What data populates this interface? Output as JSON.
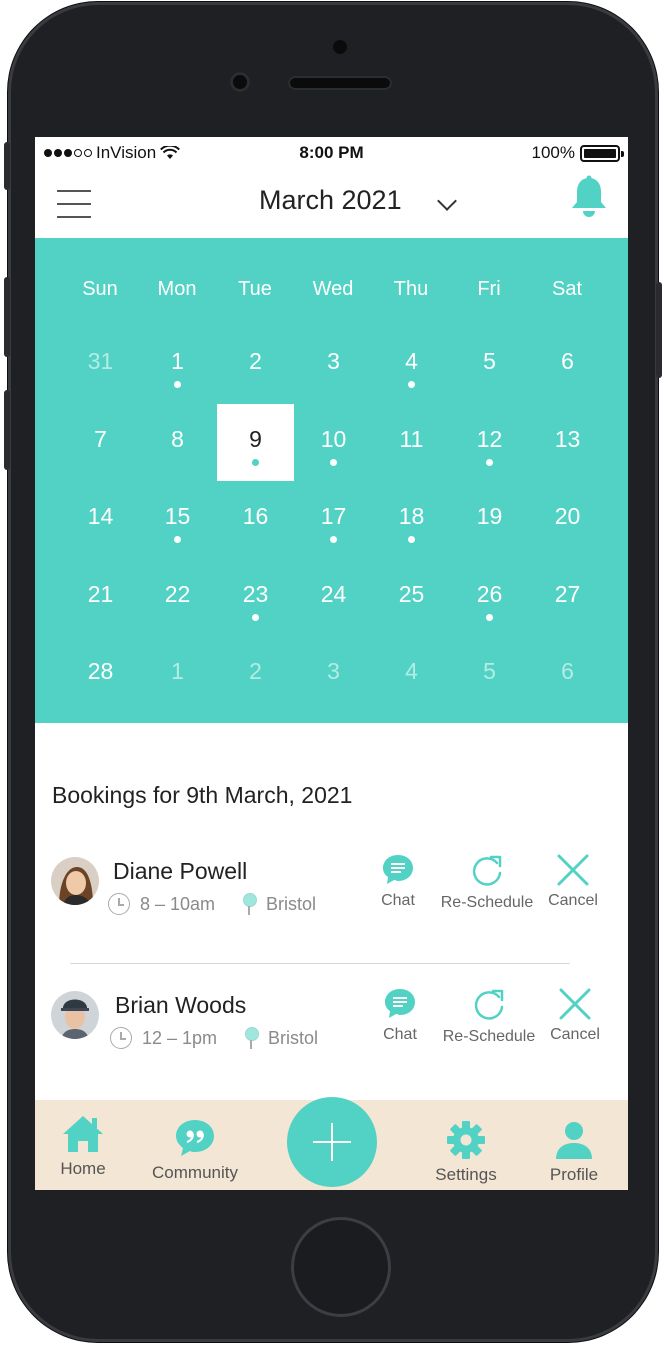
{
  "status_bar": {
    "carrier": "InVision",
    "time": "8:00 PM",
    "battery": "100%"
  },
  "header": {
    "month": "March 2021"
  },
  "calendar": {
    "weekdays": [
      "Sun",
      "Mon",
      "Tue",
      "Wed",
      "Thu",
      "Fri",
      "Sat"
    ],
    "weeks": [
      [
        {
          "d": "31",
          "muted": true
        },
        {
          "d": "1",
          "dot": true
        },
        {
          "d": "2"
        },
        {
          "d": "3"
        },
        {
          "d": "4",
          "dot": true
        },
        {
          "d": "5"
        },
        {
          "d": "6"
        }
      ],
      [
        {
          "d": "7"
        },
        {
          "d": "8"
        },
        {
          "d": "9",
          "dot": true,
          "selected": true
        },
        {
          "d": "10",
          "dot": true
        },
        {
          "d": "11"
        },
        {
          "d": "12",
          "dot": true
        },
        {
          "d": "13"
        }
      ],
      [
        {
          "d": "14"
        },
        {
          "d": "15",
          "dot": true
        },
        {
          "d": "16"
        },
        {
          "d": "17",
          "dot": true
        },
        {
          "d": "18",
          "dot": true
        },
        {
          "d": "19"
        },
        {
          "d": "20"
        }
      ],
      [
        {
          "d": "21"
        },
        {
          "d": "22"
        },
        {
          "d": "23",
          "dot": true
        },
        {
          "d": "24"
        },
        {
          "d": "25"
        },
        {
          "d": "26",
          "dot": true
        },
        {
          "d": "27"
        }
      ],
      [
        {
          "d": "28"
        },
        {
          "d": "1",
          "muted": true
        },
        {
          "d": "2",
          "muted": true
        },
        {
          "d": "3",
          "muted": true
        },
        {
          "d": "4",
          "muted": true
        },
        {
          "d": "5",
          "muted": true
        },
        {
          "d": "6",
          "muted": true
        }
      ]
    ]
  },
  "bookings": {
    "title": "Bookings for 9th March, 2021",
    "items": [
      {
        "name": "Diane Powell",
        "time": "8 – 10am",
        "location": "Bristol"
      },
      {
        "name": "Brian Woods",
        "time": "12 – 1pm",
        "location": "Bristol"
      }
    ],
    "actions": {
      "chat": "Chat",
      "reschedule": "Re-Schedule",
      "cancel": "Cancel"
    }
  },
  "tabbar": {
    "home": "Home",
    "community": "Community",
    "settings": "Settings",
    "profile": "Profile"
  },
  "colors": {
    "accent": "#52d2c4",
    "tabbar_bg": "#f4e6d4"
  },
  "icons": {
    "menu": "hamburger-menu-icon",
    "dropdown": "chevron-down-icon",
    "notifications": "bell-icon",
    "chat": "chat-bubble-icon",
    "reschedule": "refresh-icon",
    "cancel": "close-icon",
    "time": "clock-icon",
    "location": "pin-icon",
    "home": "home-icon",
    "community": "quote-bubble-icon",
    "add": "plus-icon",
    "settings": "gear-icon",
    "profile": "user-icon"
  }
}
